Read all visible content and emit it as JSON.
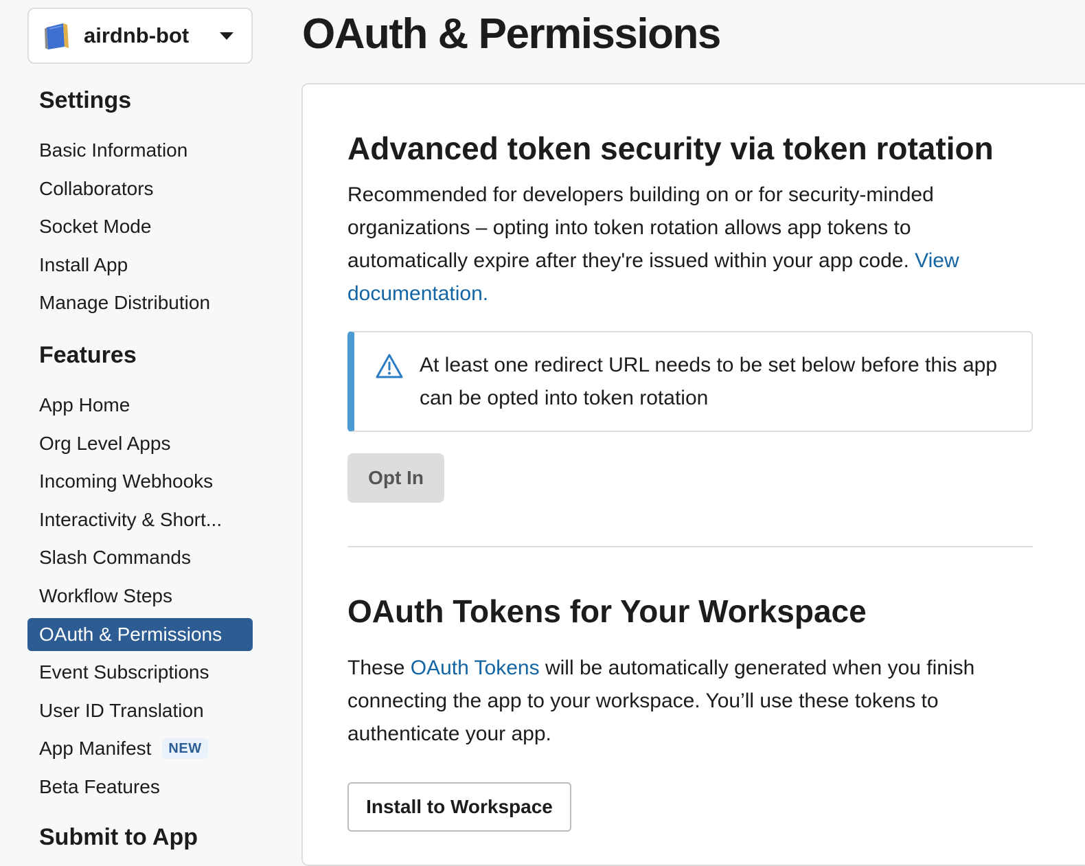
{
  "app_switcher": {
    "name": "airdnb-bot",
    "icon": "book-icon"
  },
  "sidebar": {
    "settings_title": "Settings",
    "settings_items": [
      {
        "label": "Basic Information"
      },
      {
        "label": "Collaborators"
      },
      {
        "label": "Socket Mode"
      },
      {
        "label": "Install App"
      },
      {
        "label": "Manage Distribution"
      }
    ],
    "features_title": "Features",
    "features_items": [
      {
        "label": "App Home"
      },
      {
        "label": "Org Level Apps"
      },
      {
        "label": "Incoming Webhooks"
      },
      {
        "label": "Interactivity & Short..."
      },
      {
        "label": "Slash Commands"
      },
      {
        "label": "Workflow Steps"
      },
      {
        "label": "OAuth & Permissions",
        "active": true
      },
      {
        "label": "Event Subscriptions"
      },
      {
        "label": "User ID Translation"
      },
      {
        "label": "App Manifest",
        "badge": "NEW"
      },
      {
        "label": "Beta Features"
      }
    ],
    "submit_title": "Submit to App"
  },
  "page": {
    "title": "OAuth & Permissions"
  },
  "token_rotation": {
    "heading": "Advanced token security via token rotation",
    "description": "Recommended for developers building on or for security-minded organizations – opting into token rotation allows app tokens to automatically expire after they're issued within your app code. ",
    "doc_link": "View documentation.",
    "callout_text": "At least one redirect URL needs to be set below before this app can be opted into token rotation",
    "callout_icon": "warning-icon",
    "opt_in_label": "Opt In"
  },
  "oauth_tokens": {
    "heading": "OAuth Tokens for Your Workspace",
    "text_before": "These ",
    "link": "OAuth Tokens",
    "text_after": " will be automatically generated when you finish connecting the app to your workspace. You’ll use these tokens to authenticate your app.",
    "install_label": "Install to Workspace"
  },
  "colors": {
    "accent": "#2d5c93",
    "link": "#1264a3",
    "callout_bar": "#4a9bd4"
  }
}
